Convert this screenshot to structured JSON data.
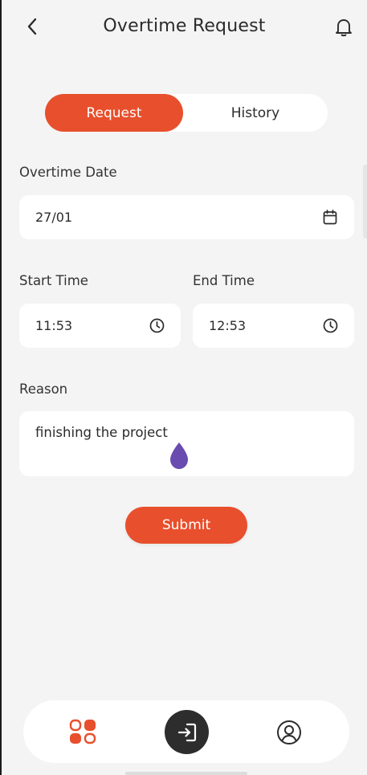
{
  "header": {
    "title": "Overtime Request",
    "back_icon": "chevron-left-icon",
    "bell_icon": "bell-icon"
  },
  "tabs": [
    {
      "label": "Request",
      "active": true
    },
    {
      "label": "History",
      "active": false
    }
  ],
  "form": {
    "date_label": "Overtime Date",
    "date_value": "27/01",
    "start_label": "Start Time",
    "start_value": "11:53",
    "end_label": "End Time",
    "end_value": "12:53",
    "reason_label": "Reason",
    "reason_value": "finishing the project"
  },
  "submit_label": "Submit",
  "bottom_nav": [
    {
      "icon": "apps-grid-icon"
    },
    {
      "icon": "login-icon"
    },
    {
      "icon": "profile-icon"
    }
  ],
  "colors": {
    "accent": "#e84f2c",
    "background": "#f4f4f4",
    "nav_center": "#2d2d2d",
    "cursor_drop": "#6a4cb0"
  }
}
